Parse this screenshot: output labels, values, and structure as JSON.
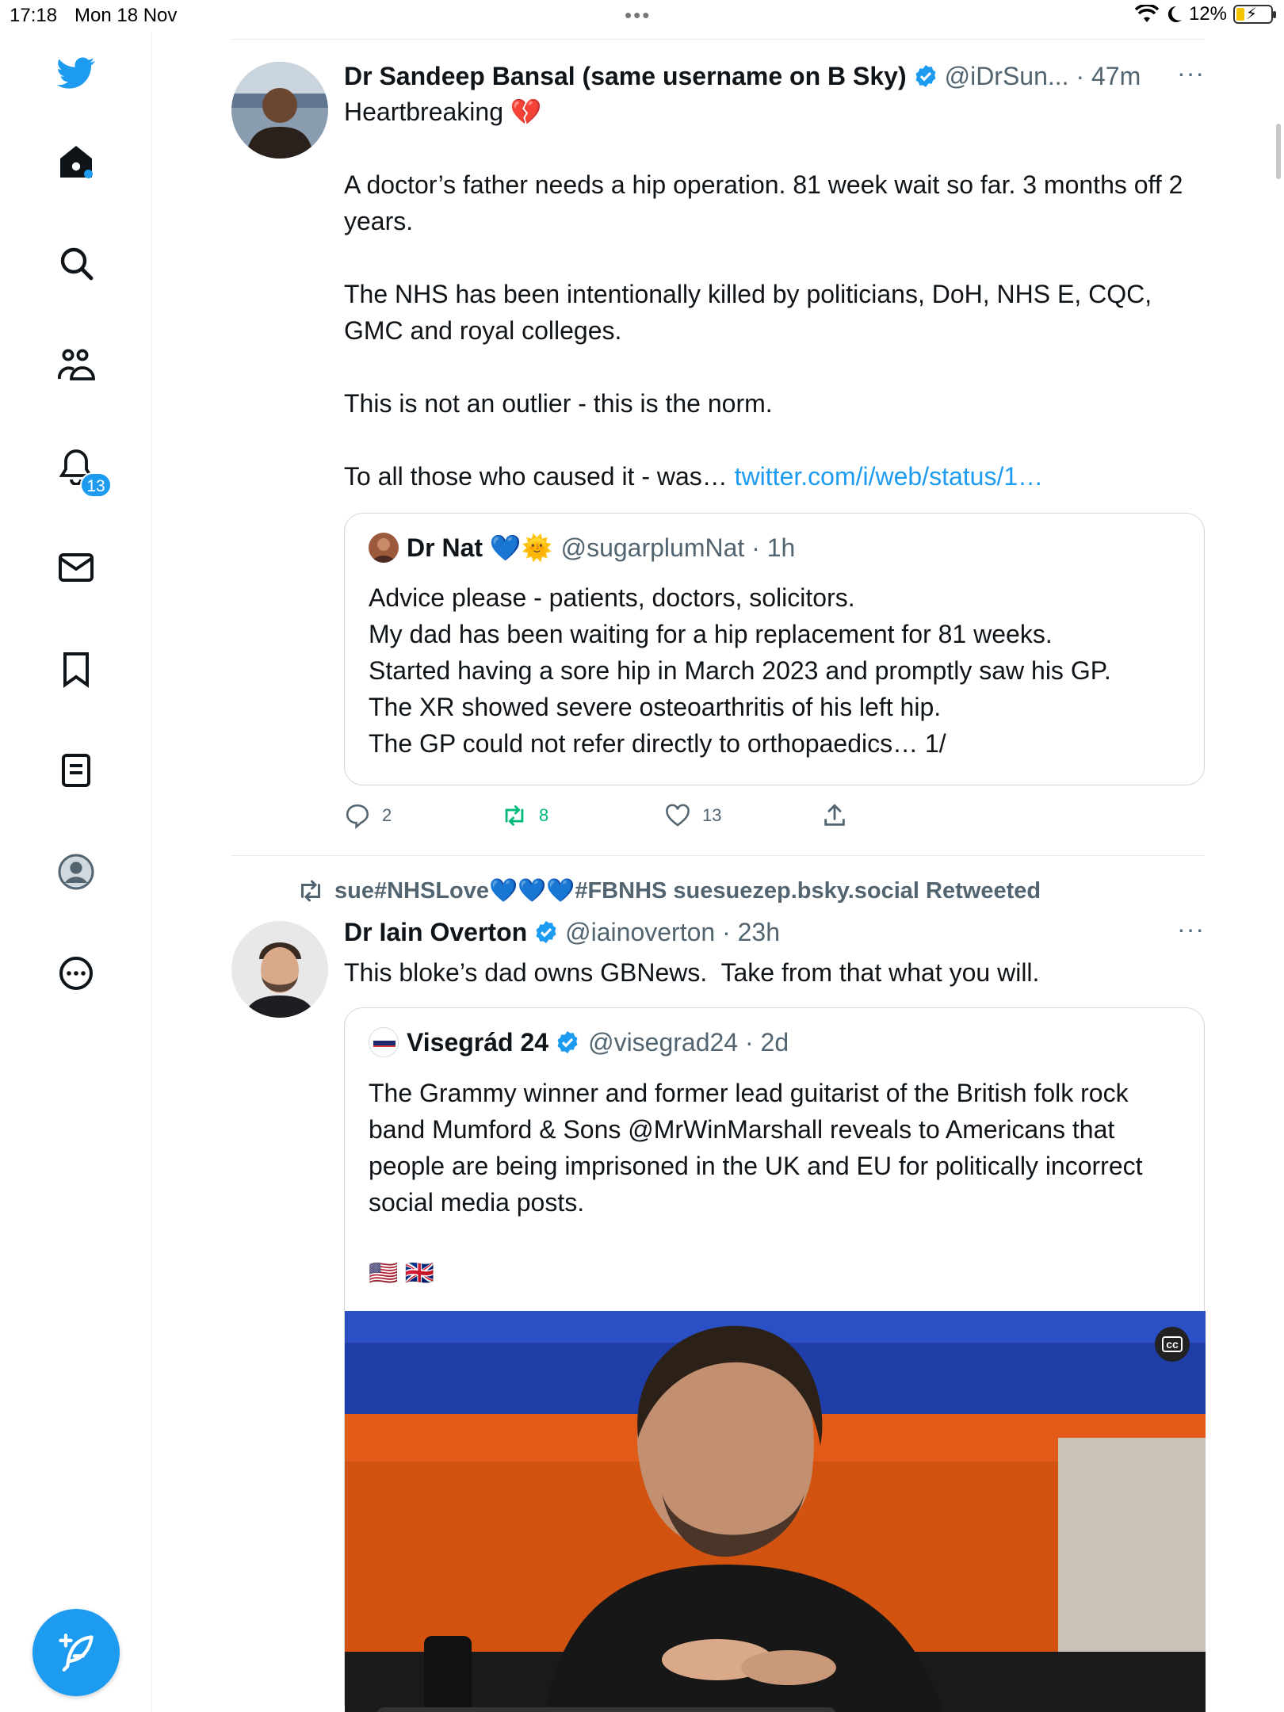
{
  "status_bar": {
    "time": "17:18",
    "date": "Mon 18 Nov",
    "battery": "12%",
    "more": "•••"
  },
  "sidebar": {
    "items": [
      {
        "icon": "twitter-logo-icon"
      },
      {
        "icon": "home-icon"
      },
      {
        "icon": "search-icon"
      },
      {
        "icon": "communities-icon"
      },
      {
        "icon": "notifications-icon",
        "badge": "13"
      },
      {
        "icon": "messages-icon"
      },
      {
        "icon": "bookmarks-icon"
      },
      {
        "icon": "lists-icon"
      },
      {
        "icon": "profile-icon"
      },
      {
        "icon": "more-icon"
      }
    ],
    "compose_icon": "compose-icon"
  },
  "colors": {
    "accent": "#1d9bf0",
    "retweet": "#00ba7c",
    "secondary_text": "#536471"
  },
  "tweets": [
    {
      "name": "Dr Sandeep Bansal (same username on B Sky)",
      "handle": "@iDrSun... · 47m",
      "more": "···",
      "text_line1": "Heartbreaking 💔",
      "text_main": "A doctor’s father needs a hip operation. 81 week wait so far. 3 months off 2 years.\n\nThe NHS has been intentionally killed by politicians, DoH, NHS E, CQC, GMC and royal colleges.\n\nThis is not an outlier - this is the norm.\n\nTo all those who caused it - was… ",
      "link": "twitter.com/i/web/status/1…",
      "quote": {
        "name": "Dr Nat 💙🌞",
        "handle": "@sugarplumNat · 1h",
        "text": "Advice please - patients, doctors, solicitors.\nMy dad has been waiting for a hip replacement for 81 weeks.\nStarted having a sore hip in March 2023 and promptly saw his GP.\nThe XR showed severe osteoarthritis of his left hip.\nThe GP could not refer directly to orthopaedics… 1/"
      },
      "actions": {
        "replies": "2",
        "retweets": "8",
        "likes": "13"
      }
    },
    {
      "retweeted_by": "sue#NHSLove💙💙💙#FBNHS suesuezep.bsky.social Retweeted",
      "name": "Dr Iain Overton",
      "handle": "@iainoverton · 23h",
      "more": "···",
      "text": "This bloke’s dad owns GBNews.  Take from that what you will.",
      "quote": {
        "name": "Visegrád 24",
        "handle": "@visegrad24 · 2d",
        "text": "The Grammy winner and former lead guitarist of the British folk rock band Mumford & Sons @MrWinMarshall reveals to Americans that people are being imprisoned in the UK and EU for politically incorrect social media posts.",
        "flags": "🇺🇸 🇬🇧",
        "media_cc": "cc"
      }
    }
  ]
}
